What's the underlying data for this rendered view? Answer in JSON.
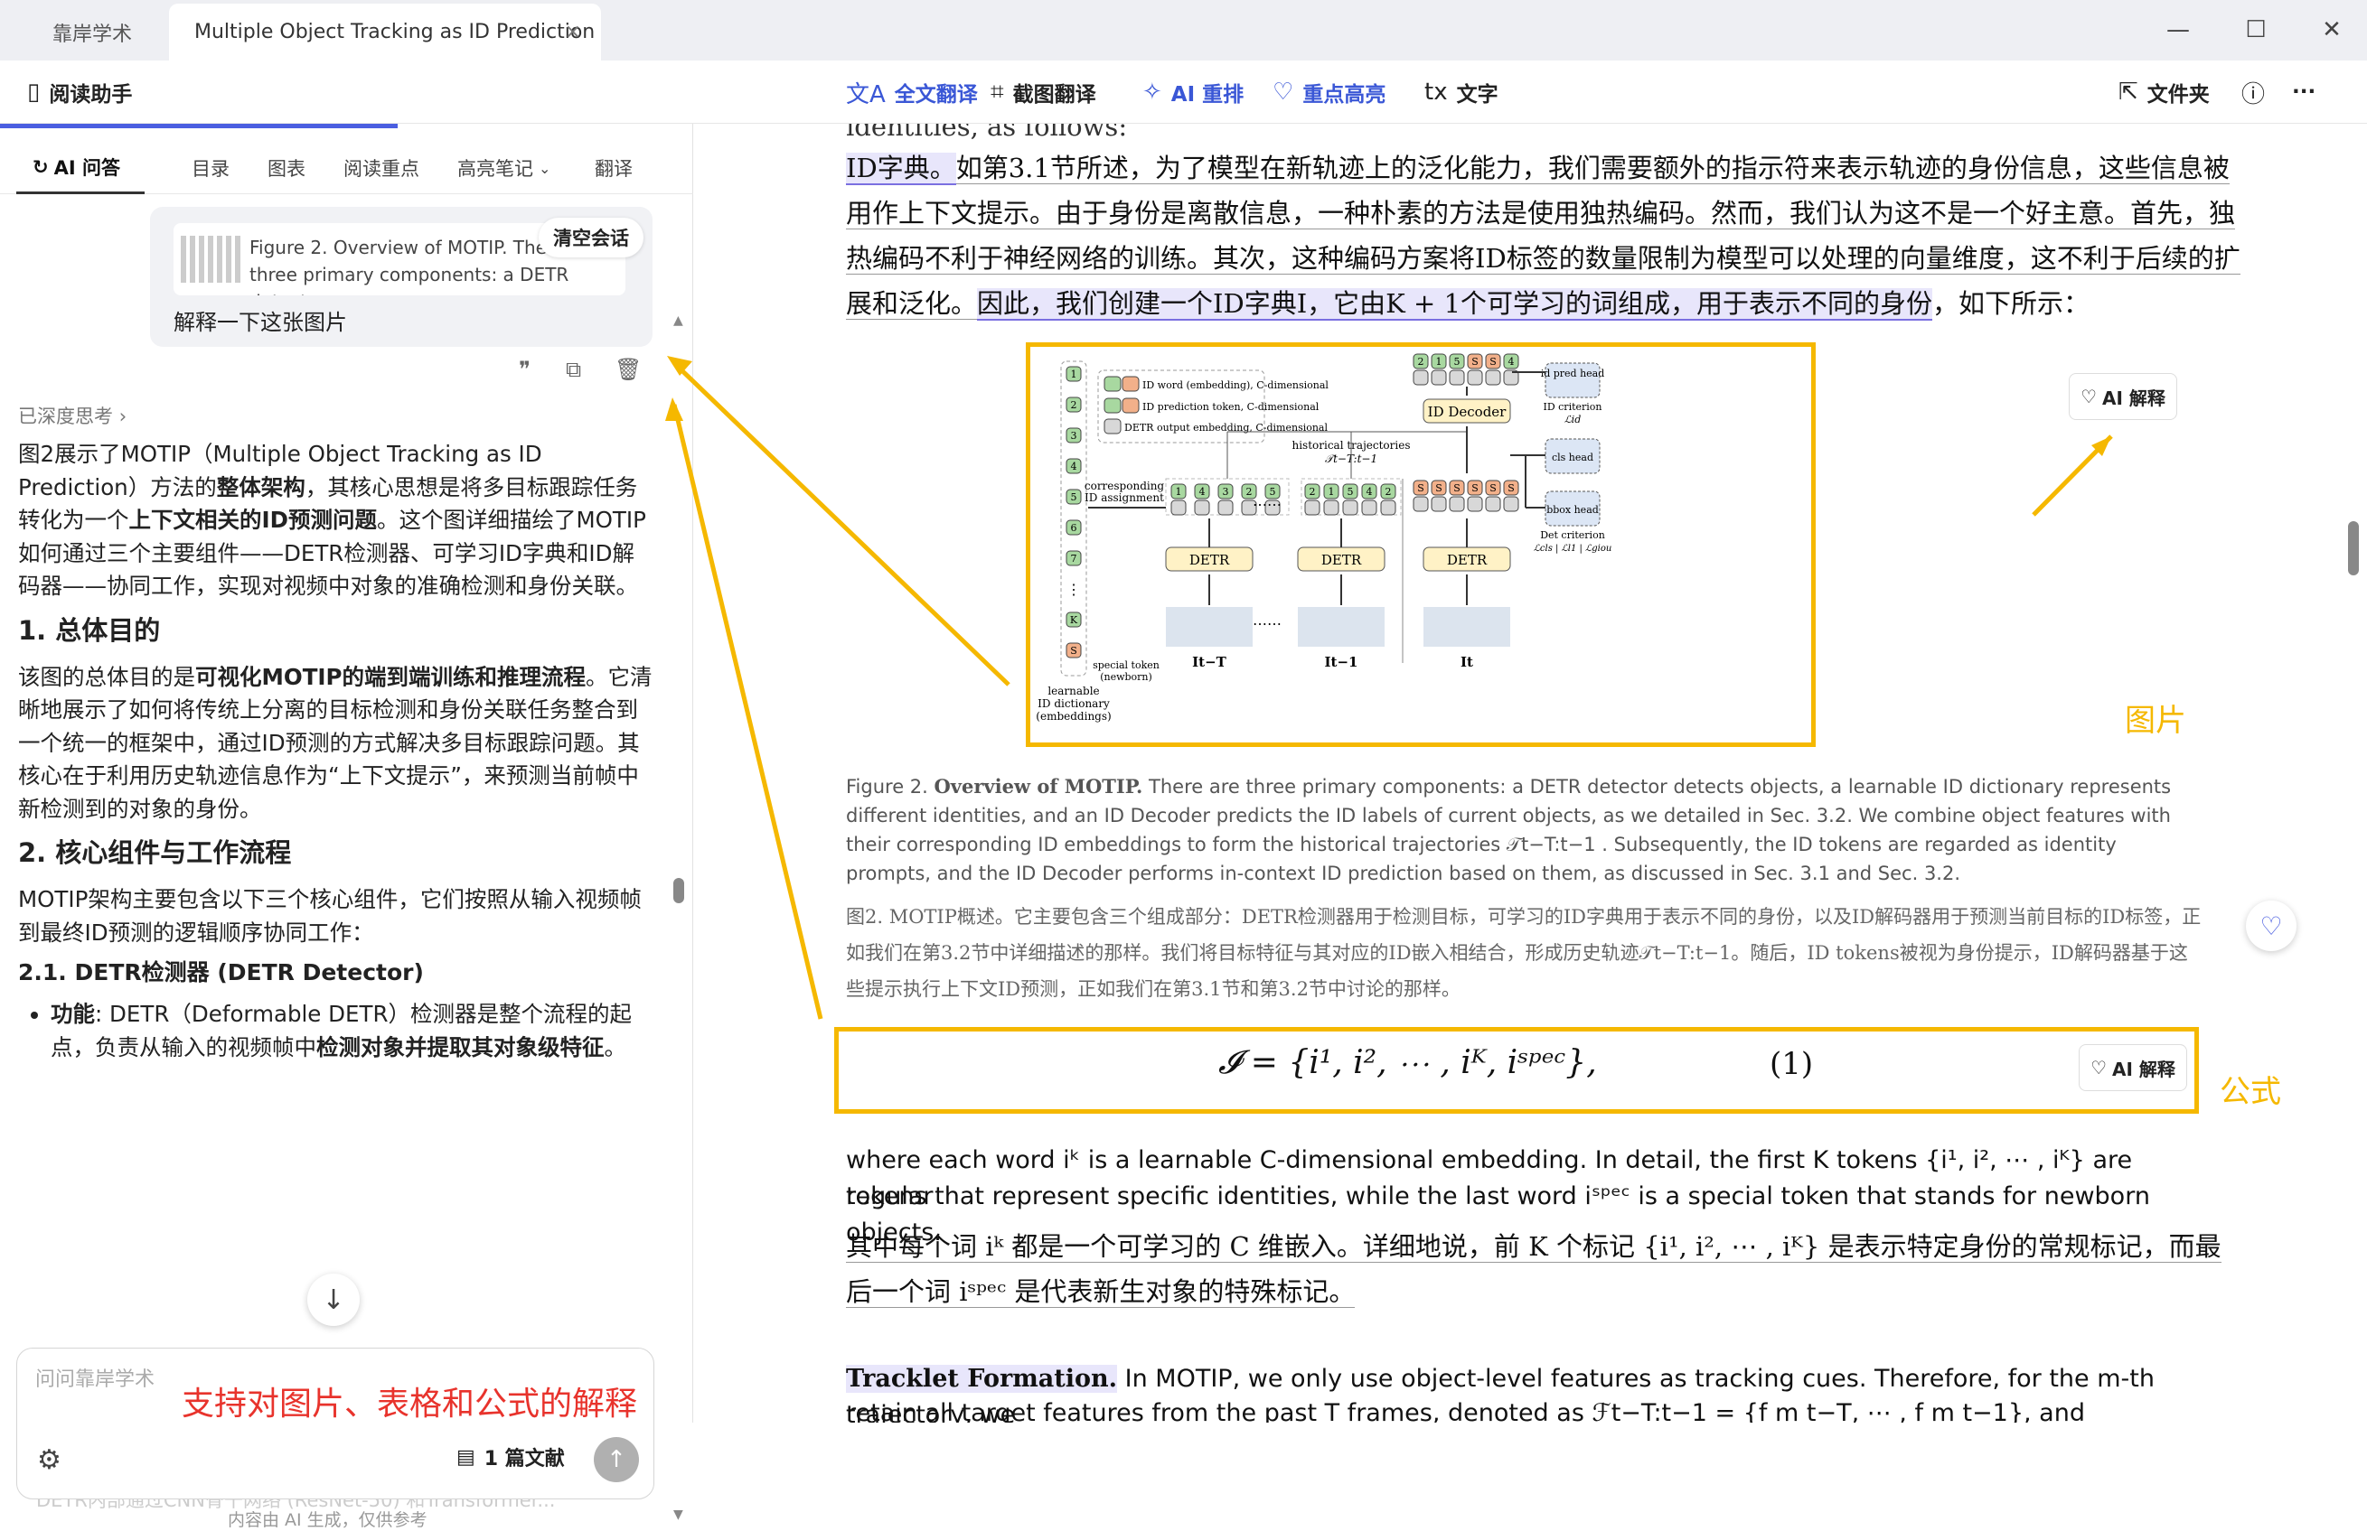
{
  "tabs": {
    "home": "靠岸学术",
    "active": "Multiple Object Tracking as ID Prediction",
    "close": "×"
  },
  "window": {
    "minimize": "—",
    "maximize": "☐",
    "close": "✕"
  },
  "left_header": {
    "title": "阅读助手"
  },
  "toolbar": {
    "full_translate": "全文翻译",
    "screenshot_translate": "截图翻译",
    "ai_reflow": "AI 重排",
    "highlight": "重点高亮",
    "text": "文字",
    "folder": "文件夹",
    "more": "···"
  },
  "subtabs": [
    "AI 问答",
    "目录",
    "图表",
    "阅读重点",
    "高亮笔记",
    "翻译"
  ],
  "chat": {
    "ref_text": "Figure 2. Overview of MOTIP. There are three primary components: a DETR detect...",
    "clear_label": "清空会话",
    "question": "解释一下这张图片",
    "thinking": "已深度思考",
    "answer_p1_pre": "图2展示了MOTIP（Multiple Object Tracking as ID Prediction）方法的",
    "answer_p1_b1": "整体架构",
    "answer_p1_mid": "，其核心思想是将多目标跟踪任务转化为一个",
    "answer_p1_b2": "上下文相关的ID预测问题",
    "answer_p1_post": "。这个图详细描绘了MOTIP如何通过三个主要组件——DETR检测器、可学习ID字典和ID解码器——协同工作，实现对视频中对象的准确检测和身份关联。",
    "h1": "1. 总体目的",
    "answer_p2_pre": "该图的总体目的是",
    "answer_p2_b": "可视化MOTIP的端到端训练和推理流程",
    "answer_p2_post": "。它清晰地展示了如何将传统上分离的目标检测和身份关联任务整合到一个统一的框架中，通过ID预测的方式解决多目标跟踪问题。其核心在于利用历史轨迹信息作为“上下文提示”，来预测当前帧中新检测到的对象的身份。",
    "h2": "2. 核心组件与工作流程",
    "answer_p3": "MOTIP架构主要包含以下三个核心组件，它们按照从输入视频帧到最终ID预测的逻辑顺序协同工作：",
    "h3": "2.1. DETR检测器 (DETR Detector)",
    "li_label": "功能",
    "li_pre": ": DETR（Deformable DETR）检测器是整个流程的起点，负责从输入的视频帧中",
    "li_b": "检测对象并提取其对象级特征",
    "li_post": "。",
    "fade_line": "DETR内部通过CNN骨干网络 (ResNet-50) 和Transformer...",
    "input_placeholder": "问问靠岸学术",
    "promo": "支持对图片、表格和公式的解释",
    "docs_label": "1 篇文献",
    "disclaimer": "内容由 AI 生成，仅供参考"
  },
  "doc": {
    "top_cut": "identities, as follows:",
    "p1_hl1": "ID字典。",
    "p1_a": "如第3.1节所述，为了模型在新轨迹上的泛化能力，我们需要额外的指示符来表示轨迹的身份信息，这些信息被",
    "p1_b": "用作上下文提示。由于身份是离散信息，一种朴素的方法是使用独热编码。然而，我们认为这不是一个好主意。首先，独",
    "p1_c": "热编码不利于神经网络的训练。其次，这种编码方案将ID标签的数量限制为模型可以处理的向量维度，这不利于后续的扩",
    "p1_d_pre": "展和泛化。",
    "p1_d_hl": "因此，我们创建一个ID字典I，它由K + 1个可学习的词组成，用于表示不同的身份",
    "p1_d_post": "，如下所示：",
    "fig_ai": "AI 解释",
    "label_figure": "图片",
    "label_formula": "公式",
    "caption_en_pre": "Figure 2. ",
    "caption_en_b": "Overview of MOTIP.",
    "caption_en": " There are three primary components: a DETR detector detects objects, a learnable ID dictionary represents different identities, and an ID Decoder predicts the ID labels of current objects, as we detailed in Sec. 3.2. We combine object features with their corresponding ID embeddings to form the historical trajectories 𝒯t−T:t−1 . Subsequently, the ID tokens are regarded as identity prompts, and the ID Decoder performs in-context ID prediction based on them, as discussed in Sec. 3.1 and Sec. 3.2.",
    "caption_cn": "图2. MOTIP概述。它主要包含三个组成部分：DETR检测器用于检测目标，可学习的ID字典用于表示不同的身份，以及ID解码器用于预测当前目标的ID标签，正如我们在第3.2节中详细描述的那样。我们将目标特征与其对应的ID嵌入相结合，形成历史轨迹𝒯t−T:t−1。随后，ID tokens被视为身份提示，ID解码器基于这些提示执行上下文ID预测，正如我们在第3.1节和第3.2节中讨论的那样。",
    "formula": "𝓘 = {i¹, i², ⋯ , iᴷ, iˢᵖᵉᶜ},",
    "eq_num": "(1)",
    "form_ai": "AI 解释",
    "en1": "where each word iᵏ is a learnable C-dimensional embedding. In detail, the first K tokens {i¹, i², ⋯ , iᴷ} are regular",
    "en2": "tokens that represent specific identities, while the last word iˢᵖᵉᶜ is a special token that stands for newborn objects.",
    "cn1": "其中每个词 iᵏ 都是一个可学习的 C 维嵌入。详细地说，前 K 个标记 {i¹, i², ⋯ , iᴷ} 是表示特定身份的常规标记，而最",
    "cn2": "后一个词 iˢᵖᵉᶜ 是代表新生对象的特殊标记。",
    "tf_b": "Tracklet Formation.",
    "tf": " In MOTIP, we only use object-level features as tracking cues. Therefore, for the m-th trajectory, we",
    "tf2": "retain all target features from the past T frames, denoted as ℱt−T:t−1 = {f m t−T, ⋯ , f m t−1}, and randomly assign a"
  },
  "figure": {
    "legend": [
      "ID word (embedding), C-dimensional",
      "ID prediction token, C-dimensional",
      "DETR output embedding, C-dimensional"
    ],
    "dict_ids": [
      "1",
      "2",
      "3",
      "4",
      "5",
      "6",
      "7",
      "⋮",
      "K",
      "S"
    ],
    "dict_label": [
      "learnable",
      "ID dictionary",
      "(embeddings)"
    ],
    "special": [
      "special token",
      "(newborn)"
    ],
    "corr": [
      "corresponding",
      "ID assignment"
    ],
    "hist": [
      "historical trajectories",
      "𝒯t−T:t−1"
    ],
    "decoder": "ID Decoder",
    "detr": "DETR",
    "frames": [
      "It−T",
      "It−1",
      "It"
    ],
    "row1": [
      "1",
      "4",
      "3",
      "2",
      "5"
    ],
    "row2": [
      "2",
      "1",
      "5",
      "4",
      "2"
    ],
    "row3": [
      "S",
      "S",
      "S",
      "S",
      "S",
      "S"
    ],
    "top_tokens": [
      "2",
      "1",
      "5",
      "S",
      "S",
      "4"
    ],
    "heads": [
      "id pred head",
      "cls head",
      "bbox head"
    ],
    "id_crit": [
      "ID criterion",
      "ℒid"
    ],
    "det_crit": [
      "Det criterion",
      "ℒcls | ℒl1 | ℒgiou"
    ],
    "dots": "⋯⋯"
  }
}
